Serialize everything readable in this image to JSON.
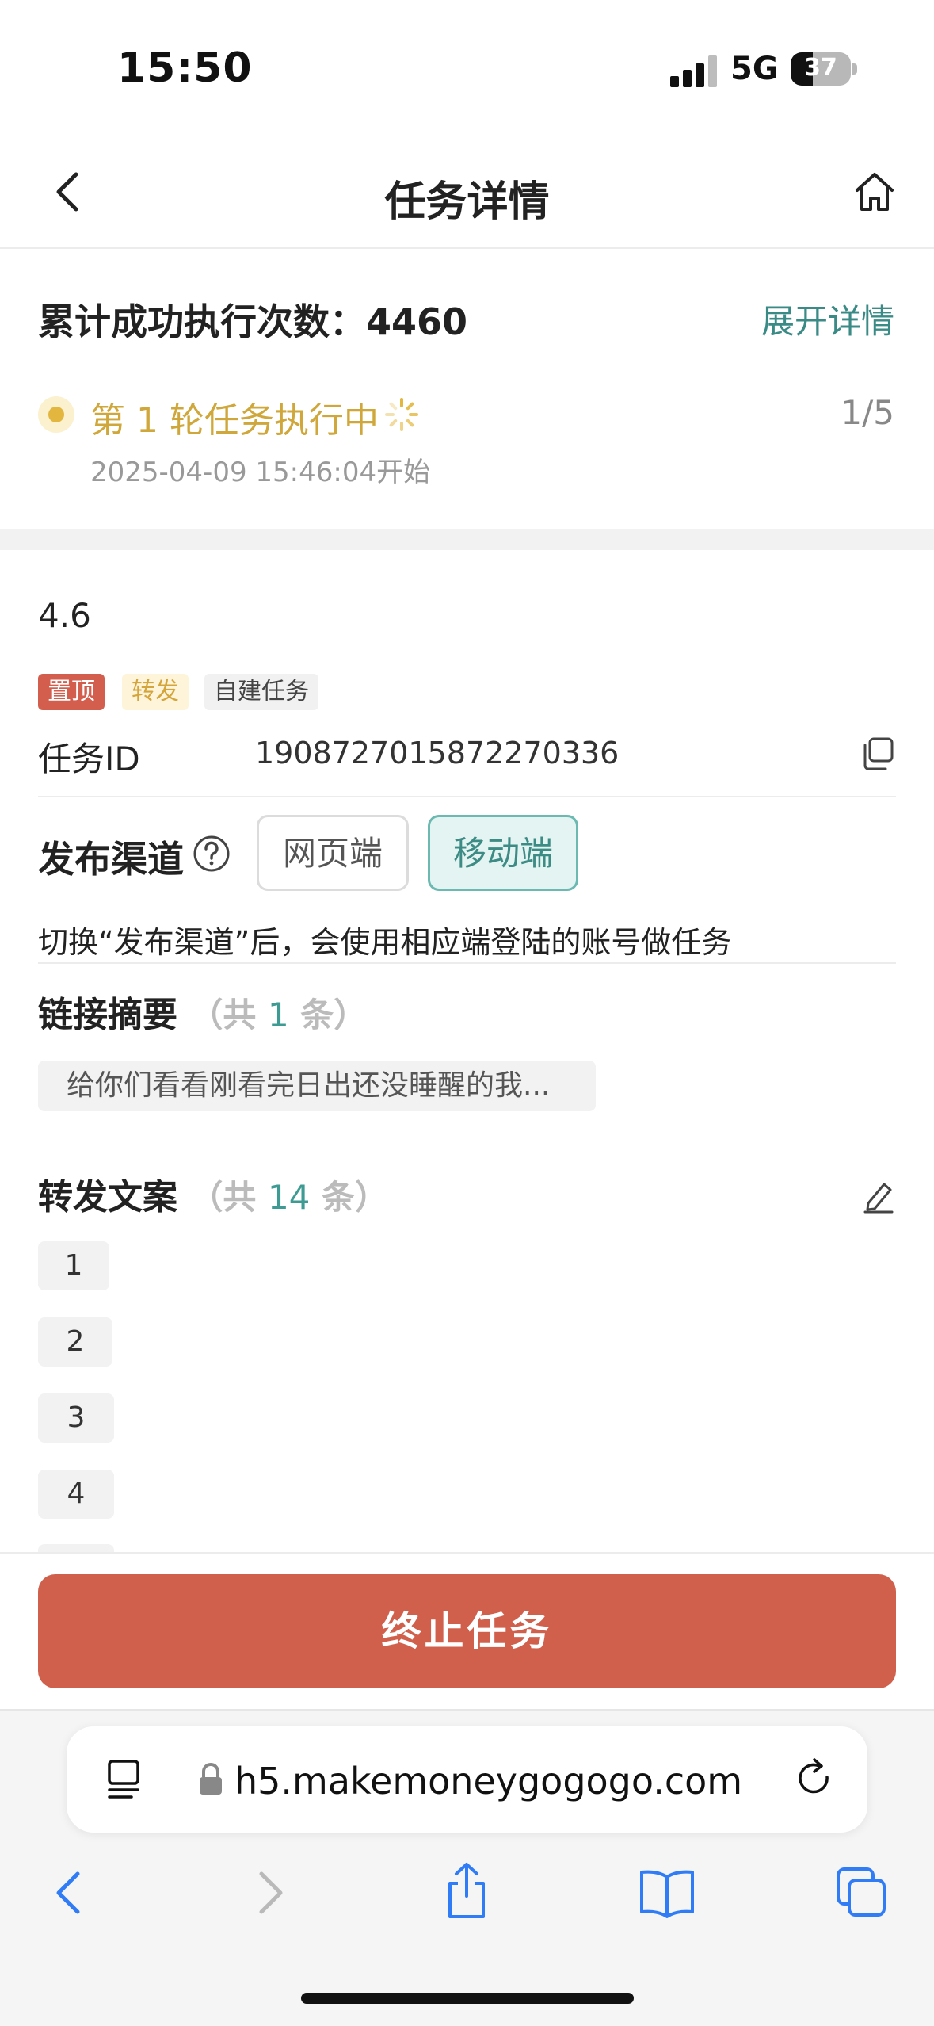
{
  "status_bar": {
    "time": "15:50",
    "network": "5G",
    "battery": "37",
    "battery_level_pct": 37
  },
  "nav": {
    "title": "任务详情",
    "back_icon": "chevron-left-icon",
    "home_icon": "home-icon"
  },
  "summary": {
    "total_label": "累计成功执行次数：4460",
    "expand_label": "展开详情",
    "round_status": "第 1 轮任务执行中",
    "round_count": "1/5",
    "round_started": "2025-04-09 15:46:04开始"
  },
  "task": {
    "name": "4.6",
    "tags": [
      "置顶",
      "转发",
      "自建任务"
    ],
    "id_label": "任务ID",
    "id_value": "1908727015872270336",
    "channel_label": "发布渠道",
    "channels": [
      "网页端",
      "移动端"
    ],
    "selected_channel": "移动端",
    "channel_note": "切换“发布渠道”后，会使用相应端登陆的账号做任务"
  },
  "link_summary": {
    "title": "链接摘要",
    "count_prefix": "（共 ",
    "count": "1",
    "count_suffix": " 条）",
    "items": [
      "给你们看看刚看完日出还没睡醒的我..."
    ]
  },
  "forward_copy": {
    "title": "转发文案",
    "count_prefix": "（共 ",
    "count": "14",
    "count_suffix": " 条）",
    "items": [
      "1",
      "2",
      "3",
      "4"
    ]
  },
  "actions": {
    "stop_label": "终止任务"
  },
  "browser": {
    "url": "h5.makemoneygogogo.com",
    "icons": [
      "reader-icon",
      "lock-icon",
      "reload-icon",
      "back-icon",
      "forward-icon",
      "share-icon",
      "bookmarks-icon",
      "tabs-icon"
    ]
  },
  "colors": {
    "accent": "#3d8b85",
    "danger": "#d05f4c",
    "warning": "#cfa73a",
    "ios_blue": "#2f7cf6"
  }
}
